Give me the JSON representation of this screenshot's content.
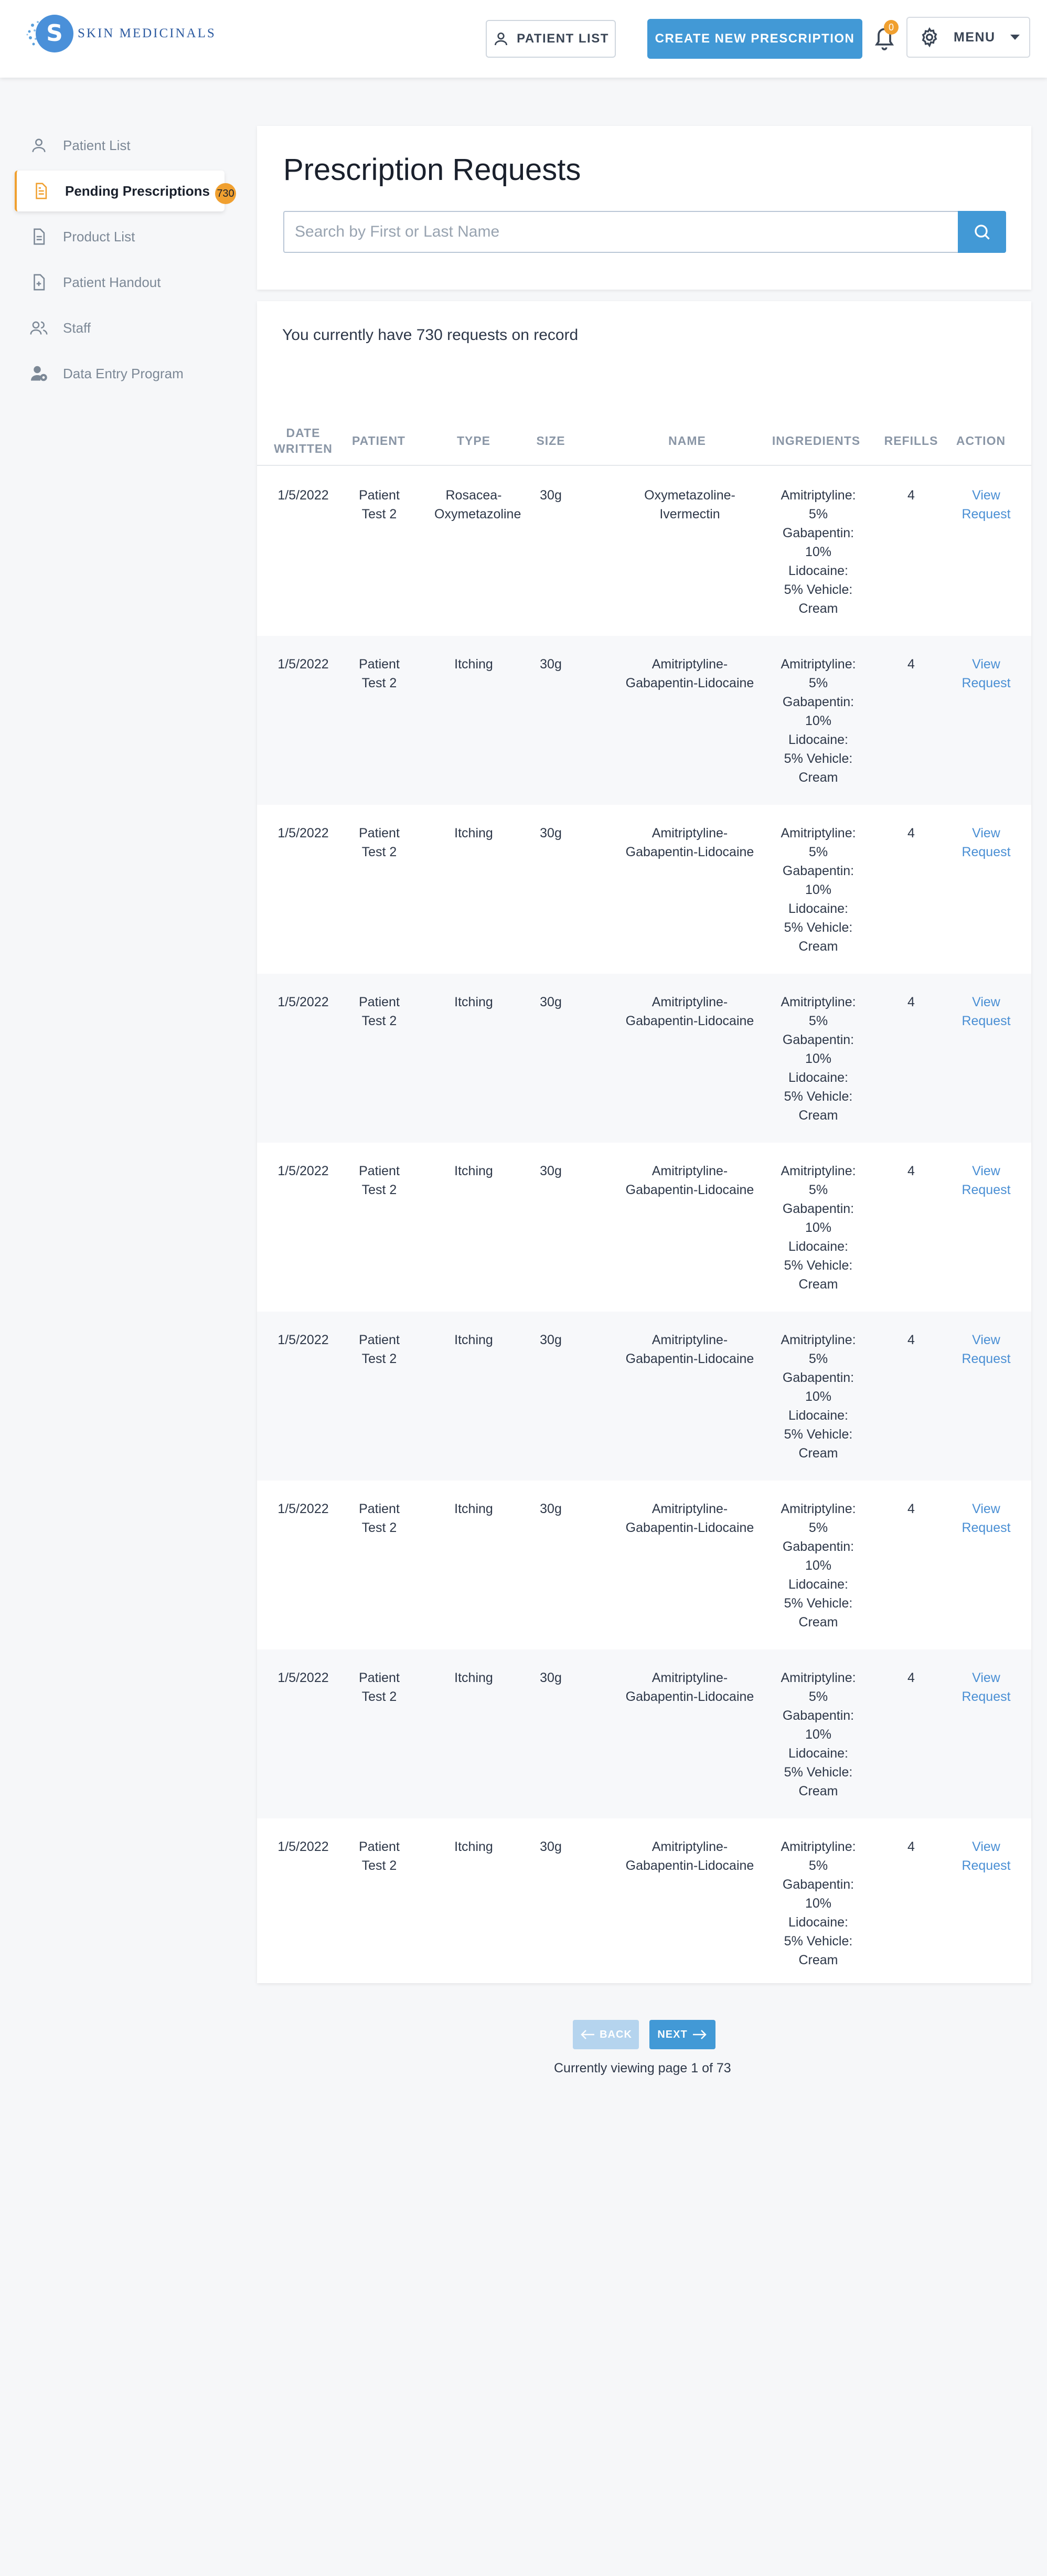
{
  "header": {
    "logo_text": "Skin Medicinals",
    "logo_letter": "S",
    "patient_list_label": "PATIENT LIST",
    "create_label": "CREATE NEW PRESCRIPTION",
    "notification_count": "0",
    "menu_label": "MENU"
  },
  "sidebar": {
    "items": [
      {
        "label": "Patient List",
        "icon": "user-icon"
      },
      {
        "label": "Pending Prescriptions",
        "icon": "document-icon",
        "badge": "730"
      },
      {
        "label": "Product List",
        "icon": "list-icon"
      },
      {
        "label": "Patient Handout",
        "icon": "file-plus-icon"
      },
      {
        "label": "Staff",
        "icon": "users-icon"
      },
      {
        "label": "Data Entry Program",
        "icon": "user-gear-icon"
      }
    ]
  },
  "main": {
    "title": "Prescription Requests",
    "search_placeholder": "Search by First or Last Name",
    "summary": "You currently have 730 requests on record"
  },
  "table": {
    "headers": [
      "DATE WRITTEN",
      "PATIENT",
      "TYPE",
      "SIZE",
      "NAME",
      "INGREDIENTS",
      "REFILLS",
      "ACTION"
    ],
    "rows": [
      {
        "date": "1/5/2022",
        "patient": "Patient Test 2",
        "type": "Rosacea-Oxymetazoline",
        "size": "30g",
        "name": "Oxymetazoline-Ivermectin",
        "ingredients": "Amitriptyline: 5% Gabapentin: 10% Lidocaine: 5% Vehicle: Cream",
        "refills": "4",
        "action": "View Request"
      },
      {
        "date": "1/5/2022",
        "patient": "Patient Test 2",
        "type": "Itching",
        "size": "30g",
        "name": "Amitriptyline-Gabapentin-Lidocaine",
        "ingredients": "Amitriptyline: 5% Gabapentin: 10% Lidocaine: 5% Vehicle: Cream",
        "refills": "4",
        "action": "View Request"
      },
      {
        "date": "1/5/2022",
        "patient": "Patient Test 2",
        "type": "Itching",
        "size": "30g",
        "name": "Amitriptyline-Gabapentin-Lidocaine",
        "ingredients": "Amitriptyline: 5% Gabapentin: 10% Lidocaine: 5% Vehicle: Cream",
        "refills": "4",
        "action": "View Request"
      },
      {
        "date": "1/5/2022",
        "patient": "Patient Test 2",
        "type": "Itching",
        "size": "30g",
        "name": "Amitriptyline-Gabapentin-Lidocaine",
        "ingredients": "Amitriptyline: 5% Gabapentin: 10% Lidocaine: 5% Vehicle: Cream",
        "refills": "4",
        "action": "View Request"
      },
      {
        "date": "1/5/2022",
        "patient": "Patient Test 2",
        "type": "Itching",
        "size": "30g",
        "name": "Amitriptyline-Gabapentin-Lidocaine",
        "ingredients": "Amitriptyline: 5% Gabapentin: 10% Lidocaine: 5% Vehicle: Cream",
        "refills": "4",
        "action": "View Request"
      },
      {
        "date": "1/5/2022",
        "patient": "Patient Test 2",
        "type": "Itching",
        "size": "30g",
        "name": "Amitriptyline-Gabapentin-Lidocaine",
        "ingredients": "Amitriptyline: 5% Gabapentin: 10% Lidocaine: 5% Vehicle: Cream",
        "refills": "4",
        "action": "View Request"
      },
      {
        "date": "1/5/2022",
        "patient": "Patient Test 2",
        "type": "Itching",
        "size": "30g",
        "name": "Amitriptyline-Gabapentin-Lidocaine",
        "ingredients": "Amitriptyline: 5% Gabapentin: 10% Lidocaine: 5% Vehicle: Cream",
        "refills": "4",
        "action": "View Request"
      },
      {
        "date": "1/5/2022",
        "patient": "Patient Test 2",
        "type": "Itching",
        "size": "30g",
        "name": "Amitriptyline-Gabapentin-Lidocaine",
        "ingredients": "Amitriptyline: 5% Gabapentin: 10% Lidocaine: 5% Vehicle: Cream",
        "refills": "4",
        "action": "View Request"
      },
      {
        "date": "1/5/2022",
        "patient": "Patient Test 2",
        "type": "Itching",
        "size": "30g",
        "name": "Amitriptyline-Gabapentin-Lidocaine",
        "ingredients": "Amitriptyline: 5% Gabapentin: 10% Lidocaine: 5% Vehicle: Cream",
        "refills": "4",
        "action": "View Request"
      }
    ]
  },
  "pagination": {
    "back_label": "BACK",
    "next_label": "NEXT",
    "page_info": "Currently viewing page 1 of 73"
  },
  "colors": {
    "accent": "#4299d6",
    "badge": "#f0a030",
    "link": "#4a8fd4"
  }
}
